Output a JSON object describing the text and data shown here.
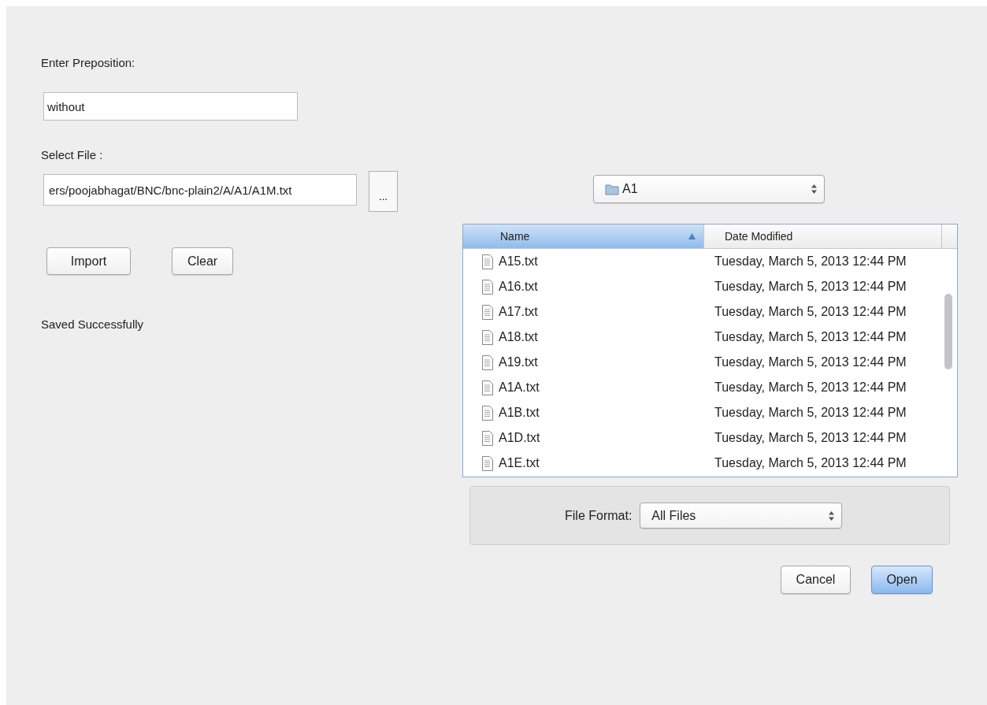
{
  "preposition": {
    "label": "Enter Preposition:",
    "value": "without"
  },
  "select_file": {
    "label": "Select File :",
    "value": "ers/poojabhagat/BNC/bnc-plain2/A/A1/A1M.txt",
    "browse_button": "..."
  },
  "actions": [
    {
      "label": "Import"
    },
    {
      "label": "Clear"
    }
  ],
  "status": "Saved Successfully",
  "file_dialog": {
    "folder": "A1",
    "columns": [
      {
        "label": "Name",
        "selected": true
      },
      {
        "label": "Date Modified",
        "selected": false
      }
    ],
    "rows": [
      {
        "name": "A15.txt",
        "date": "Tuesday, March 5, 2013 12:44 PM"
      },
      {
        "name": "A16.txt",
        "date": "Tuesday, March 5, 2013 12:44 PM"
      },
      {
        "name": "A17.txt",
        "date": "Tuesday, March 5, 2013 12:44 PM"
      },
      {
        "name": "A18.txt",
        "date": "Tuesday, March 5, 2013 12:44 PM"
      },
      {
        "name": "A19.txt",
        "date": "Tuesday, March 5, 2013 12:44 PM"
      },
      {
        "name": "A1A.txt",
        "date": "Tuesday, March 5, 2013 12:44 PM"
      },
      {
        "name": "A1B.txt",
        "date": "Tuesday, March 5, 2013 12:44 PM"
      },
      {
        "name": "A1D.txt",
        "date": "Tuesday, March 5, 2013 12:44 PM"
      },
      {
        "name": "A1E.txt",
        "date": "Tuesday, March 5, 2013 12:44 PM"
      }
    ],
    "format_label": "File Format:",
    "format_value": "All Files",
    "buttons": [
      {
        "label": "Cancel",
        "default": false
      },
      {
        "label": "Open",
        "default": true
      }
    ]
  }
}
